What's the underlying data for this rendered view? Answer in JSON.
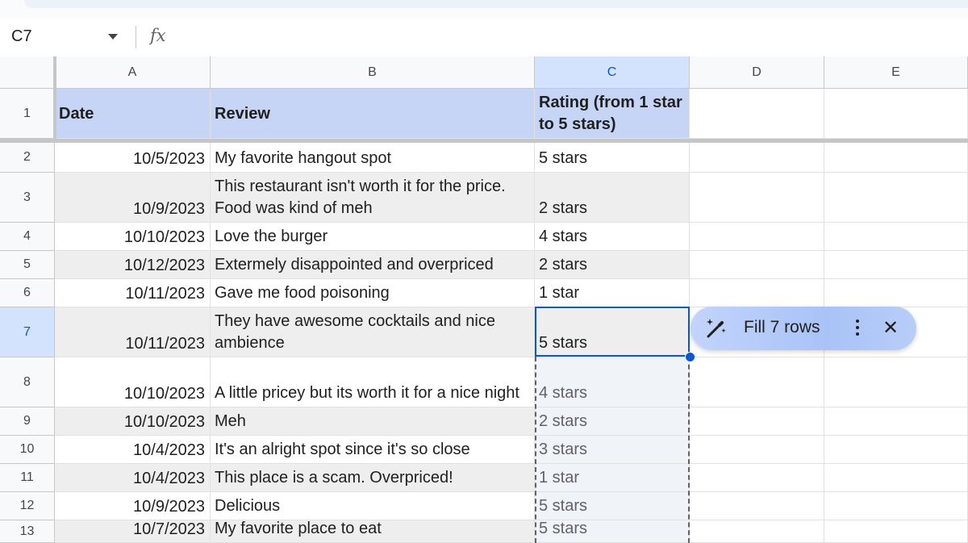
{
  "name_box": "C7",
  "formula_icon": "fx",
  "columns": [
    "A",
    "B",
    "C",
    "D",
    "E"
  ],
  "header_row": {
    "row": "1",
    "date": "Date",
    "review": "Review",
    "rating": "Rating (from 1 star to 5 stars)"
  },
  "rows": [
    {
      "row": "2",
      "date": "10/5/2023",
      "review": "My favorite hangout spot",
      "rating": "5 stars"
    },
    {
      "row": "3",
      "date": "10/9/2023",
      "review": "This restaurant isn't worth it for the price. Food was kind of meh",
      "rating": "2 stars"
    },
    {
      "row": "4",
      "date": "10/10/2023",
      "review": "Love the burger",
      "rating": "4 stars"
    },
    {
      "row": "5",
      "date": "10/12/2023",
      "review": "Extermely disappointed and overpriced",
      "rating": "2 stars"
    },
    {
      "row": "6",
      "date": "10/11/2023",
      "review": "Gave me food poisoning",
      "rating": "1 star"
    },
    {
      "row": "7",
      "date": "10/11/2023",
      "review": "They have awesome cocktails and nice ambience",
      "rating": "5 stars"
    },
    {
      "row": "8",
      "date": "10/10/2023",
      "review": "A little pricey but its worth it for a nice night",
      "rating": "4 stars"
    },
    {
      "row": "9",
      "date": "10/10/2023",
      "review": "Meh",
      "rating": "2 stars"
    },
    {
      "row": "10",
      "date": "10/4/2023",
      "review": "It's an alright spot since it's so close",
      "rating": "3 stars"
    },
    {
      "row": "11",
      "date": "10/4/2023",
      "review": "This place is a scam. Overpriced!",
      "rating": "1 star"
    },
    {
      "row": "12",
      "date": "10/9/2023",
      "review": "Delicious",
      "rating": "5 stars"
    },
    {
      "row": "13",
      "date": "10/7/2023",
      "review": "My favorite place to eat",
      "rating": "5 stars"
    }
  ],
  "fill_chip": {
    "label": "Fill 7 rows",
    "icons": [
      "magic-wand-icon",
      "more-vert-icon",
      "close-icon"
    ]
  },
  "colors": {
    "header_fill": "#c6d5f5",
    "selection": "#0b57d0",
    "selected_header": "#d3e3fd"
  }
}
